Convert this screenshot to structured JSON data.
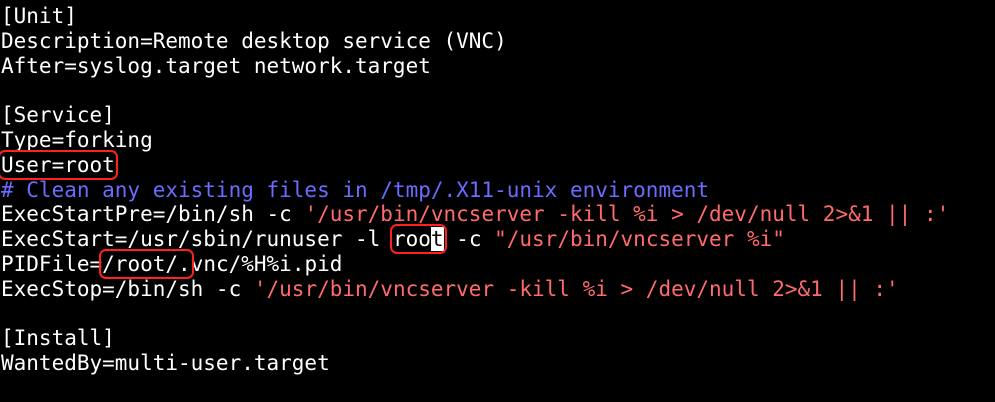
{
  "colors": {
    "background": "#000000",
    "text": "#ffffff",
    "string": "#ff6b6b",
    "comment": "#6b6bff",
    "highlight_box": "#ff2020"
  },
  "lines": {
    "l1": "[Unit]",
    "l2": "Description=Remote desktop service (VNC)",
    "l3": "After=syslog.target network.target",
    "l5": "[Service]",
    "l6": "Type=forking",
    "l7": "User=root",
    "l8": "# Clean any existing files in /tmp/.X11-unix environment",
    "l9_key": "ExecStartPre=/bin/sh -c ",
    "l9_str": "'/usr/bin/vncserver -kill %i > /dev/null 2>&1 || :'",
    "l10_key": "ExecStart=/usr/sbin/runuser -l ",
    "l10_user_a": "roo",
    "l10_user_cursor": "t",
    "l10_mid": " -c ",
    "l10_str": "\"/usr/bin/vncserver %i\"",
    "l11_key": "PIDFile=",
    "l11_path": "/root/.",
    "l11_rest": "vnc/%H%i.pid",
    "l12_key": "ExecStop=/bin/sh -c ",
    "l12_str": "'/usr/bin/vncserver -kill %i > /dev/null 2>&1 || :'",
    "l14": "[Install]",
    "l15": "WantedBy=multi-user.target"
  }
}
